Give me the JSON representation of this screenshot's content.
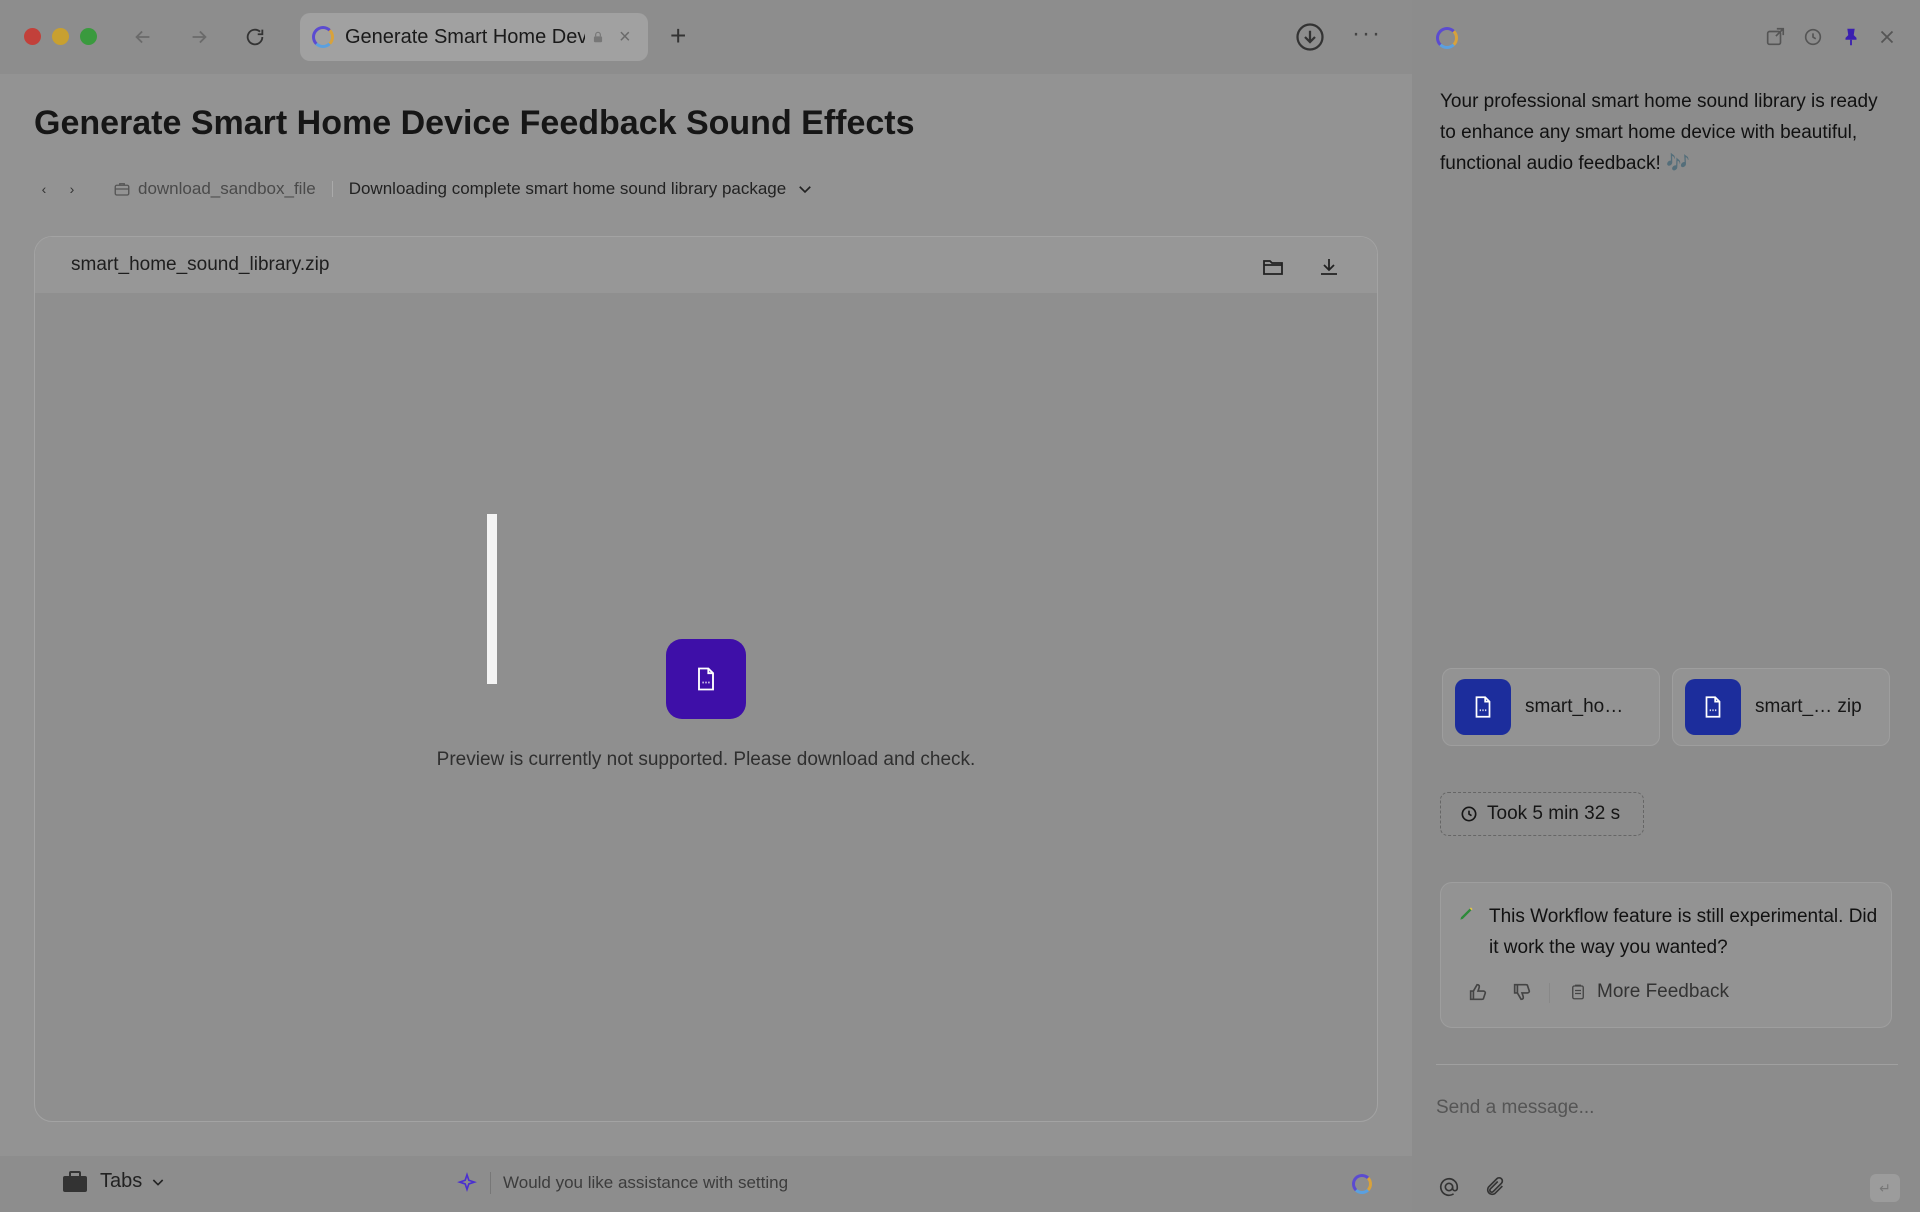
{
  "browser": {
    "tab_title": "Generate Smart Home Dev",
    "new_tab_label": "+",
    "more_label": "···"
  },
  "page": {
    "title": "Generate Smart Home Device Feedback Sound Effects",
    "breadcrumb": {
      "tool": "download_sandbox_file",
      "description": "Downloading complete smart home sound library package"
    },
    "file": {
      "name": "smart_home_sound_library.zip",
      "preview_message": "Preview is currently not supported. Please download and check."
    }
  },
  "bottom_bar": {
    "tabs_label": "Tabs",
    "assist_text": "Would you like assistance with setting"
  },
  "chat": {
    "summary": "Your professional smart home sound library is ready to enhance any smart home device with beautiful, functional audio feedback! 🎶",
    "attachments": [
      {
        "label": "smart_ho…"
      },
      {
        "label": "smart_… zip"
      }
    ],
    "took": "Took 5 min 32 s",
    "feedback": {
      "text": "This Workflow feature is still experimental. Did it work the way you wanted?",
      "more_label": "More Feedback"
    },
    "input_placeholder": "Send a message...",
    "send_icon": "↵"
  },
  "colors": {
    "accent": "#3e0fa8",
    "file_icon_bg": "#1c2d9c",
    "close_red": "#c2403a",
    "minimize_yellow": "#c8a030",
    "maximize_green": "#3a9a3e"
  }
}
